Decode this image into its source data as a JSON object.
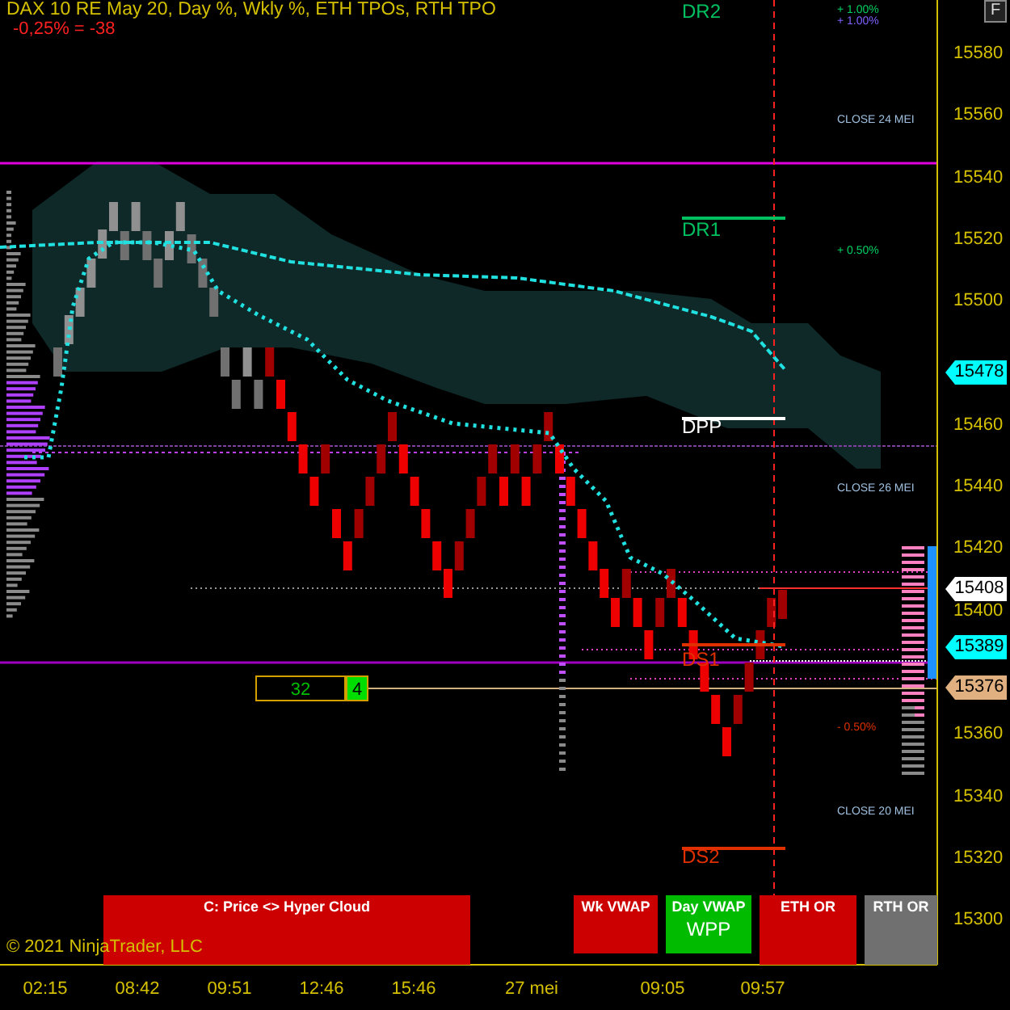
{
  "header": {
    "title": "DAX 10 RE May 20, Day %, Wkly %, ETH TPOs, RTH TPO",
    "change": "-0,25% = -38"
  },
  "corner_button": "F",
  "levels": [
    {
      "label": "DR2",
      "color": "#00c060"
    },
    {
      "label": "DR1",
      "color": "#00c060"
    },
    {
      "label": "DPP",
      "color": "#ffffff"
    },
    {
      "label": "DS1",
      "color": "#e03000"
    },
    {
      "label": "DS2",
      "color": "#e03000"
    }
  ],
  "annotations": [
    {
      "text": "+ 1.00%",
      "color": "#00d060"
    },
    {
      "text": "+ 1.00%",
      "color": "#8060ff"
    },
    {
      "text": "CLOSE 24 MEI",
      "color": "#a0c0e0"
    },
    {
      "text": "+ 0.50%",
      "color": "#00d060"
    },
    {
      "text": "CLOSE 26 MEI",
      "color": "#a0c0e0"
    },
    {
      "text": "- 0.50%",
      "color": "#e03000"
    },
    {
      "text": "CLOSE 20 MEI",
      "color": "#a0c0e0"
    }
  ],
  "price_axis": {
    "ticks": [
      "15580",
      "15560",
      "15540",
      "15520",
      "15500",
      "15460",
      "15440",
      "15420",
      "15400",
      "15360",
      "15340",
      "15320",
      "15300"
    ],
    "markers": [
      {
        "value": "15478",
        "color": "#00ffff"
      },
      {
        "value": "15408",
        "color": "#ffffff"
      },
      {
        "value": "15389",
        "color": "#00ffff"
      },
      {
        "value": "15376",
        "color": "#e0b080"
      }
    ]
  },
  "time_axis": [
    "02:15",
    "08:42",
    "09:51",
    "12:46",
    "15:46",
    "27 mei",
    "09:05",
    "09:57"
  ],
  "counter": {
    "value": "32",
    "count": "4"
  },
  "signal_panels": [
    {
      "label": "C: Price <> Hyper Cloud",
      "color": "#cc0000"
    },
    {
      "label": "Wk VWAP",
      "color": "#cc0000"
    },
    {
      "label": "Day VWAP",
      "sublabel": "WPP",
      "color": "#00bb00"
    },
    {
      "label": "ETH OR",
      "color": "#cc0000"
    },
    {
      "label": "RTH OR",
      "color": "#707070"
    }
  ],
  "copyright": "© 2021 NinjaTrader, LLC"
}
